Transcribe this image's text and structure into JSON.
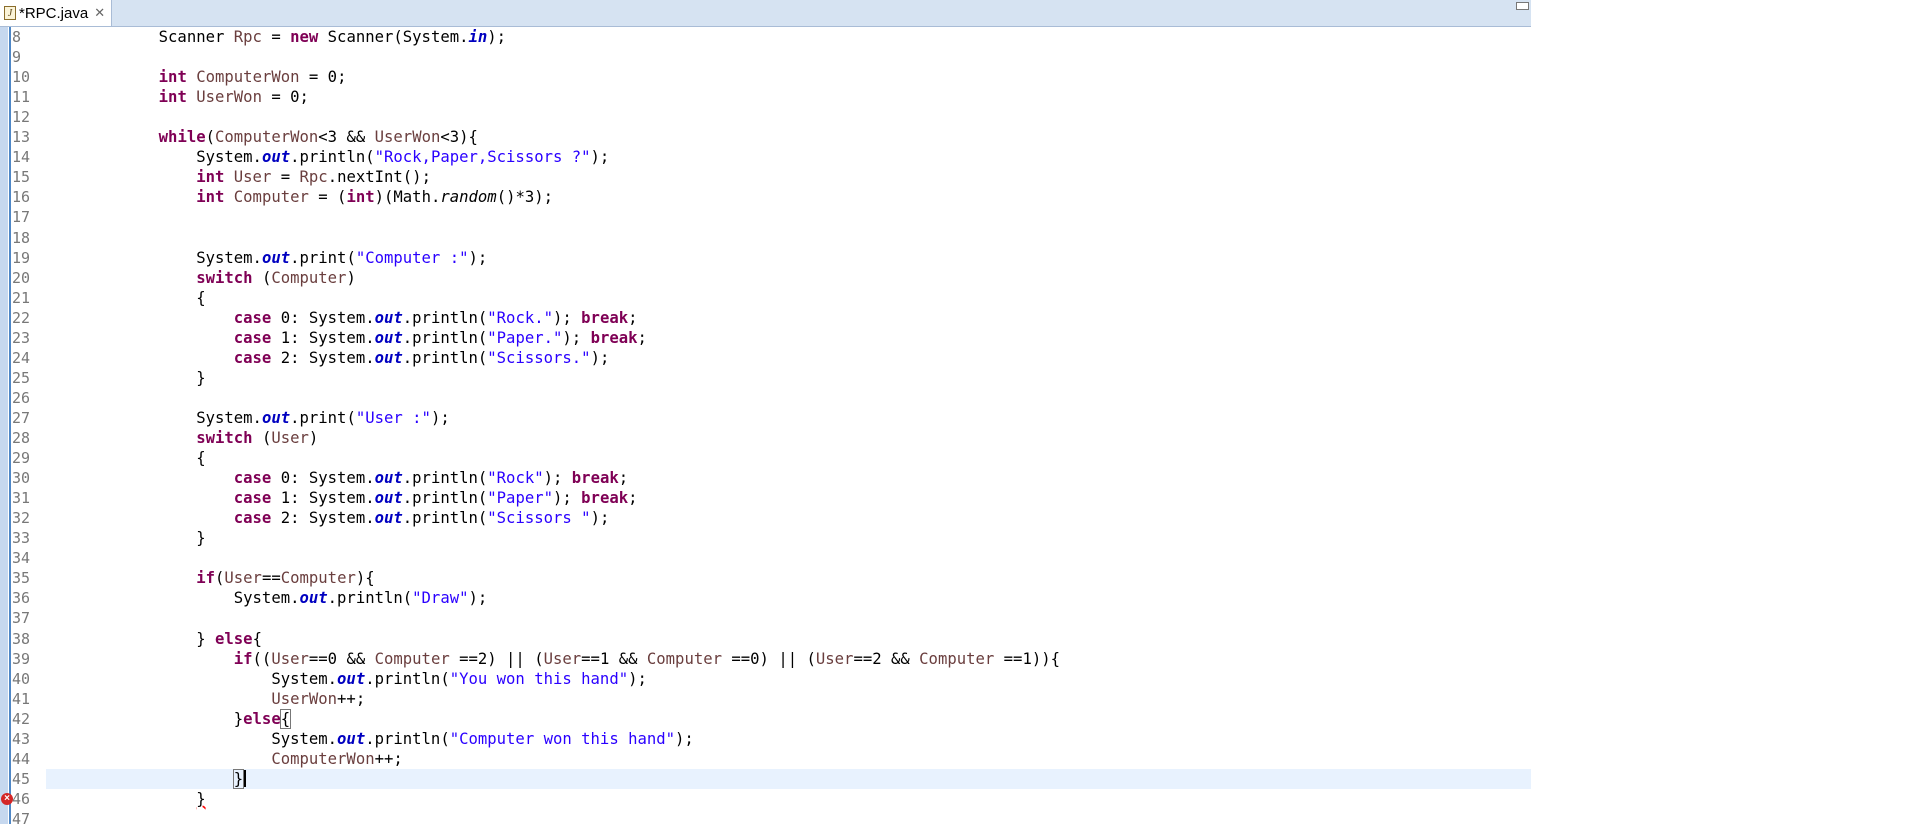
{
  "tab": {
    "title": "*RPC.java",
    "icon": "java-file-icon",
    "close_icon": "close-icon"
  },
  "editor": {
    "lines": [
      {
        "n": "8",
        "tokens": [
          [
            "p",
            "            Scanner "
          ],
          [
            "v",
            "Rpc"
          ],
          [
            "p",
            " = "
          ],
          [
            "k",
            "new"
          ],
          [
            "p",
            " Scanner(System."
          ],
          [
            "f",
            "in"
          ],
          [
            "p",
            ");"
          ]
        ]
      },
      {
        "n": "9",
        "tokens": []
      },
      {
        "n": "10",
        "tokens": [
          [
            "p",
            "            "
          ],
          [
            "k",
            "int"
          ],
          [
            "p",
            " "
          ],
          [
            "v",
            "ComputerWon"
          ],
          [
            "p",
            " = 0;"
          ]
        ]
      },
      {
        "n": "11",
        "tokens": [
          [
            "p",
            "            "
          ],
          [
            "k",
            "int"
          ],
          [
            "p",
            " "
          ],
          [
            "v",
            "UserWon"
          ],
          [
            "p",
            " = 0;"
          ]
        ]
      },
      {
        "n": "12",
        "tokens": []
      },
      {
        "n": "13",
        "tokens": [
          [
            "p",
            "            "
          ],
          [
            "k",
            "while"
          ],
          [
            "p",
            "("
          ],
          [
            "v",
            "ComputerWon"
          ],
          [
            "p",
            "<3 && "
          ],
          [
            "v",
            "UserWon"
          ],
          [
            "p",
            "<3){"
          ]
        ]
      },
      {
        "n": "14",
        "tokens": [
          [
            "p",
            "                System."
          ],
          [
            "f",
            "out"
          ],
          [
            "p",
            ".println("
          ],
          [
            "s",
            "\"Rock,Paper,Scissors ?\""
          ],
          [
            "p",
            ");"
          ]
        ]
      },
      {
        "n": "15",
        "tokens": [
          [
            "p",
            "                "
          ],
          [
            "k",
            "int"
          ],
          [
            "p",
            " "
          ],
          [
            "v",
            "User"
          ],
          [
            "p",
            " = "
          ],
          [
            "v",
            "Rpc"
          ],
          [
            "p",
            ".nextInt();"
          ]
        ]
      },
      {
        "n": "16",
        "tokens": [
          [
            "p",
            "                "
          ],
          [
            "k",
            "int"
          ],
          [
            "p",
            " "
          ],
          [
            "v",
            "Computer"
          ],
          [
            "p",
            " = ("
          ],
          [
            "k",
            "int"
          ],
          [
            "p",
            ")(Math."
          ],
          [
            "i",
            "random"
          ],
          [
            "p",
            "()*3);"
          ]
        ]
      },
      {
        "n": "17",
        "tokens": []
      },
      {
        "n": "18",
        "tokens": []
      },
      {
        "n": "19",
        "tokens": [
          [
            "p",
            "                System."
          ],
          [
            "f",
            "out"
          ],
          [
            "p",
            ".print("
          ],
          [
            "s",
            "\"Computer :\""
          ],
          [
            "p",
            ");"
          ]
        ]
      },
      {
        "n": "20",
        "tokens": [
          [
            "p",
            "                "
          ],
          [
            "k",
            "switch"
          ],
          [
            "p",
            " ("
          ],
          [
            "v",
            "Computer"
          ],
          [
            "p",
            ")"
          ]
        ]
      },
      {
        "n": "21",
        "tokens": [
          [
            "p",
            "                {"
          ]
        ]
      },
      {
        "n": "22",
        "tokens": [
          [
            "p",
            "                    "
          ],
          [
            "k",
            "case"
          ],
          [
            "p",
            " 0: System."
          ],
          [
            "f",
            "out"
          ],
          [
            "p",
            ".println("
          ],
          [
            "s",
            "\"Rock.\""
          ],
          [
            "p",
            "); "
          ],
          [
            "k",
            "break"
          ],
          [
            "p",
            ";"
          ]
        ]
      },
      {
        "n": "23",
        "tokens": [
          [
            "p",
            "                    "
          ],
          [
            "k",
            "case"
          ],
          [
            "p",
            " 1: System."
          ],
          [
            "f",
            "out"
          ],
          [
            "p",
            ".println("
          ],
          [
            "s",
            "\"Paper.\""
          ],
          [
            "p",
            "); "
          ],
          [
            "k",
            "break"
          ],
          [
            "p",
            ";"
          ]
        ]
      },
      {
        "n": "24",
        "tokens": [
          [
            "p",
            "                    "
          ],
          [
            "k",
            "case"
          ],
          [
            "p",
            " 2: System."
          ],
          [
            "f",
            "out"
          ],
          [
            "p",
            ".println("
          ],
          [
            "s",
            "\"Scissors.\""
          ],
          [
            "p",
            ");"
          ]
        ]
      },
      {
        "n": "25",
        "tokens": [
          [
            "p",
            "                }"
          ]
        ]
      },
      {
        "n": "26",
        "tokens": []
      },
      {
        "n": "27",
        "tokens": [
          [
            "p",
            "                System."
          ],
          [
            "f",
            "out"
          ],
          [
            "p",
            ".print("
          ],
          [
            "s",
            "\"User :\""
          ],
          [
            "p",
            ");"
          ]
        ]
      },
      {
        "n": "28",
        "tokens": [
          [
            "p",
            "                "
          ],
          [
            "k",
            "switch"
          ],
          [
            "p",
            " ("
          ],
          [
            "v",
            "User"
          ],
          [
            "p",
            ")"
          ]
        ]
      },
      {
        "n": "29",
        "tokens": [
          [
            "p",
            "                {"
          ]
        ]
      },
      {
        "n": "30",
        "tokens": [
          [
            "p",
            "                    "
          ],
          [
            "k",
            "case"
          ],
          [
            "p",
            " 0: System."
          ],
          [
            "f",
            "out"
          ],
          [
            "p",
            ".println("
          ],
          [
            "s",
            "\"Rock\""
          ],
          [
            "p",
            "); "
          ],
          [
            "k",
            "break"
          ],
          [
            "p",
            ";"
          ]
        ]
      },
      {
        "n": "31",
        "tokens": [
          [
            "p",
            "                    "
          ],
          [
            "k",
            "case"
          ],
          [
            "p",
            " 1: System."
          ],
          [
            "f",
            "out"
          ],
          [
            "p",
            ".println("
          ],
          [
            "s",
            "\"Paper\""
          ],
          [
            "p",
            "); "
          ],
          [
            "k",
            "break"
          ],
          [
            "p",
            ";"
          ]
        ]
      },
      {
        "n": "32",
        "tokens": [
          [
            "p",
            "                    "
          ],
          [
            "k",
            "case"
          ],
          [
            "p",
            " 2: System."
          ],
          [
            "f",
            "out"
          ],
          [
            "p",
            ".println("
          ],
          [
            "s",
            "\"Scissors \""
          ],
          [
            "p",
            ");"
          ]
        ]
      },
      {
        "n": "33",
        "tokens": [
          [
            "p",
            "                }"
          ]
        ]
      },
      {
        "n": "34",
        "tokens": []
      },
      {
        "n": "35",
        "tokens": [
          [
            "p",
            "                "
          ],
          [
            "k",
            "if"
          ],
          [
            "p",
            "("
          ],
          [
            "v",
            "User"
          ],
          [
            "p",
            "=="
          ],
          [
            "v",
            "Computer"
          ],
          [
            "p",
            "){"
          ]
        ]
      },
      {
        "n": "36",
        "tokens": [
          [
            "p",
            "                    System."
          ],
          [
            "f",
            "out"
          ],
          [
            "p",
            ".println("
          ],
          [
            "s",
            "\"Draw\""
          ],
          [
            "p",
            ");"
          ]
        ]
      },
      {
        "n": "37",
        "tokens": []
      },
      {
        "n": "38",
        "tokens": [
          [
            "p",
            "                } "
          ],
          [
            "k",
            "else"
          ],
          [
            "p",
            "{"
          ]
        ]
      },
      {
        "n": "39",
        "tokens": [
          [
            "p",
            "                    "
          ],
          [
            "k",
            "if"
          ],
          [
            "p",
            "(("
          ],
          [
            "v",
            "User"
          ],
          [
            "p",
            "==0 && "
          ],
          [
            "v",
            "Computer"
          ],
          [
            "p",
            " ==2) || ("
          ],
          [
            "v",
            "User"
          ],
          [
            "p",
            "==1 && "
          ],
          [
            "v",
            "Computer"
          ],
          [
            "p",
            " ==0) || ("
          ],
          [
            "v",
            "User"
          ],
          [
            "p",
            "==2 && "
          ],
          [
            "v",
            "Computer"
          ],
          [
            "p",
            " ==1)){"
          ]
        ]
      },
      {
        "n": "40",
        "tokens": [
          [
            "p",
            "                        System."
          ],
          [
            "f",
            "out"
          ],
          [
            "p",
            ".println("
          ],
          [
            "s",
            "\"You won this hand\""
          ],
          [
            "p",
            ");"
          ]
        ]
      },
      {
        "n": "41",
        "tokens": [
          [
            "p",
            "                        "
          ],
          [
            "v",
            "UserWon"
          ],
          [
            "p",
            "++;"
          ]
        ]
      },
      {
        "n": "42",
        "tokens": [
          [
            "p",
            "                    }"
          ],
          [
            "k",
            "else"
          ],
          [
            "b",
            "{"
          ]
        ]
      },
      {
        "n": "43",
        "tokens": [
          [
            "p",
            "                        System."
          ],
          [
            "f",
            "out"
          ],
          [
            "p",
            ".println("
          ],
          [
            "s",
            "\"Computer won this hand\""
          ],
          [
            "p",
            ");"
          ]
        ]
      },
      {
        "n": "44",
        "tokens": [
          [
            "p",
            "                        "
          ],
          [
            "v",
            "ComputerWon"
          ],
          [
            "p",
            "++;"
          ]
        ]
      },
      {
        "n": "45",
        "tokens": [
          [
            "p",
            "                    "
          ],
          [
            "b",
            "}"
          ],
          [
            "c",
            ""
          ]
        ],
        "current": true
      },
      {
        "n": "46",
        "tokens": [
          [
            "p",
            "                "
          ],
          [
            "e",
            "}"
          ]
        ],
        "error": true
      },
      {
        "n": "47",
        "tokens": []
      }
    ]
  },
  "colors": {
    "keyword": "#7f0055",
    "variable": "#6a3e3e",
    "string": "#2a00ff",
    "field": "#0000c0",
    "line_number": "#787878",
    "current_line": "#e8f2fe",
    "tab_bar": "#d6e3f2"
  }
}
